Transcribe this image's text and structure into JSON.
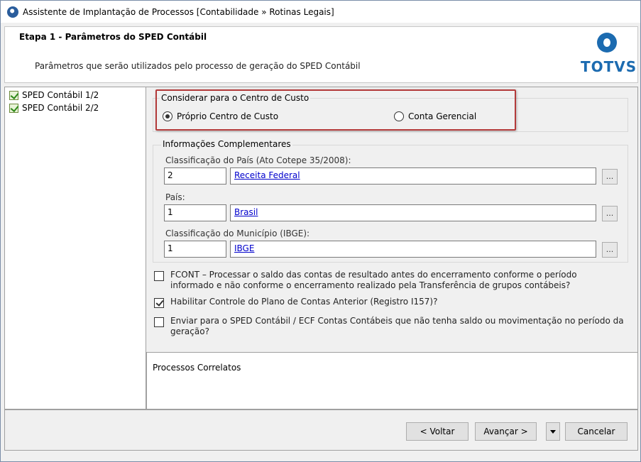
{
  "window": {
    "title": "Assistente de Implantação de Processos [Contabilidade » Rotinas Legais]"
  },
  "header": {
    "step_title": "Etapa 1 - Parâmetros do SPED Contábil",
    "description": "Parâmetros que serão utilizados pelo processo de geração do SPED Contábil",
    "logo_text": "TOTVS",
    "brand_color": "#1c6bb0"
  },
  "tree": {
    "items": [
      {
        "label": "SPED Contábil 1/2",
        "icon": "checked-task-icon"
      },
      {
        "label": "SPED Contábil 2/2",
        "icon": "checked-task-icon"
      }
    ]
  },
  "cost_center": {
    "label": "Considerar para o Centro de Custo",
    "options": [
      {
        "label": "Próprio Centro de Custo",
        "selected": true
      },
      {
        "label": "Conta Gerencial",
        "selected": false
      }
    ]
  },
  "complementary": {
    "label": "Informações Complementares",
    "fields": [
      {
        "label": "Classificação do País (Ato Cotepe 35/2008):",
        "code": "2",
        "link": "Receita Federal",
        "button": "..."
      },
      {
        "label": "País:",
        "code": "1",
        "link": "Brasil",
        "button": "..."
      },
      {
        "label": "Classificação do Município (IBGE):",
        "code": "1",
        "link": "IBGE",
        "button": "..."
      }
    ]
  },
  "checkboxes": [
    {
      "label": "FCONT – Processar o saldo das contas de resultado antes do encerramento conforme o período informado e não conforme o encerramento realizado pela Transferência de grupos contábeis?",
      "checked": false
    },
    {
      "label": "Habilitar Controle do Plano de Contas Anterior (Registro I157)?",
      "checked": true
    },
    {
      "label": "Enviar para o SPED Contábil / ECF Contas Contábeis que não tenha saldo ou movimentação no período da geração?",
      "checked": false
    }
  ],
  "related": {
    "title": "Processos Correlatos"
  },
  "footer": {
    "back": "< Voltar",
    "next": "Avançar >",
    "cancel": "Cancelar"
  },
  "colors": {
    "highlight_border": "#b33a3a",
    "link": "#0000cc"
  }
}
